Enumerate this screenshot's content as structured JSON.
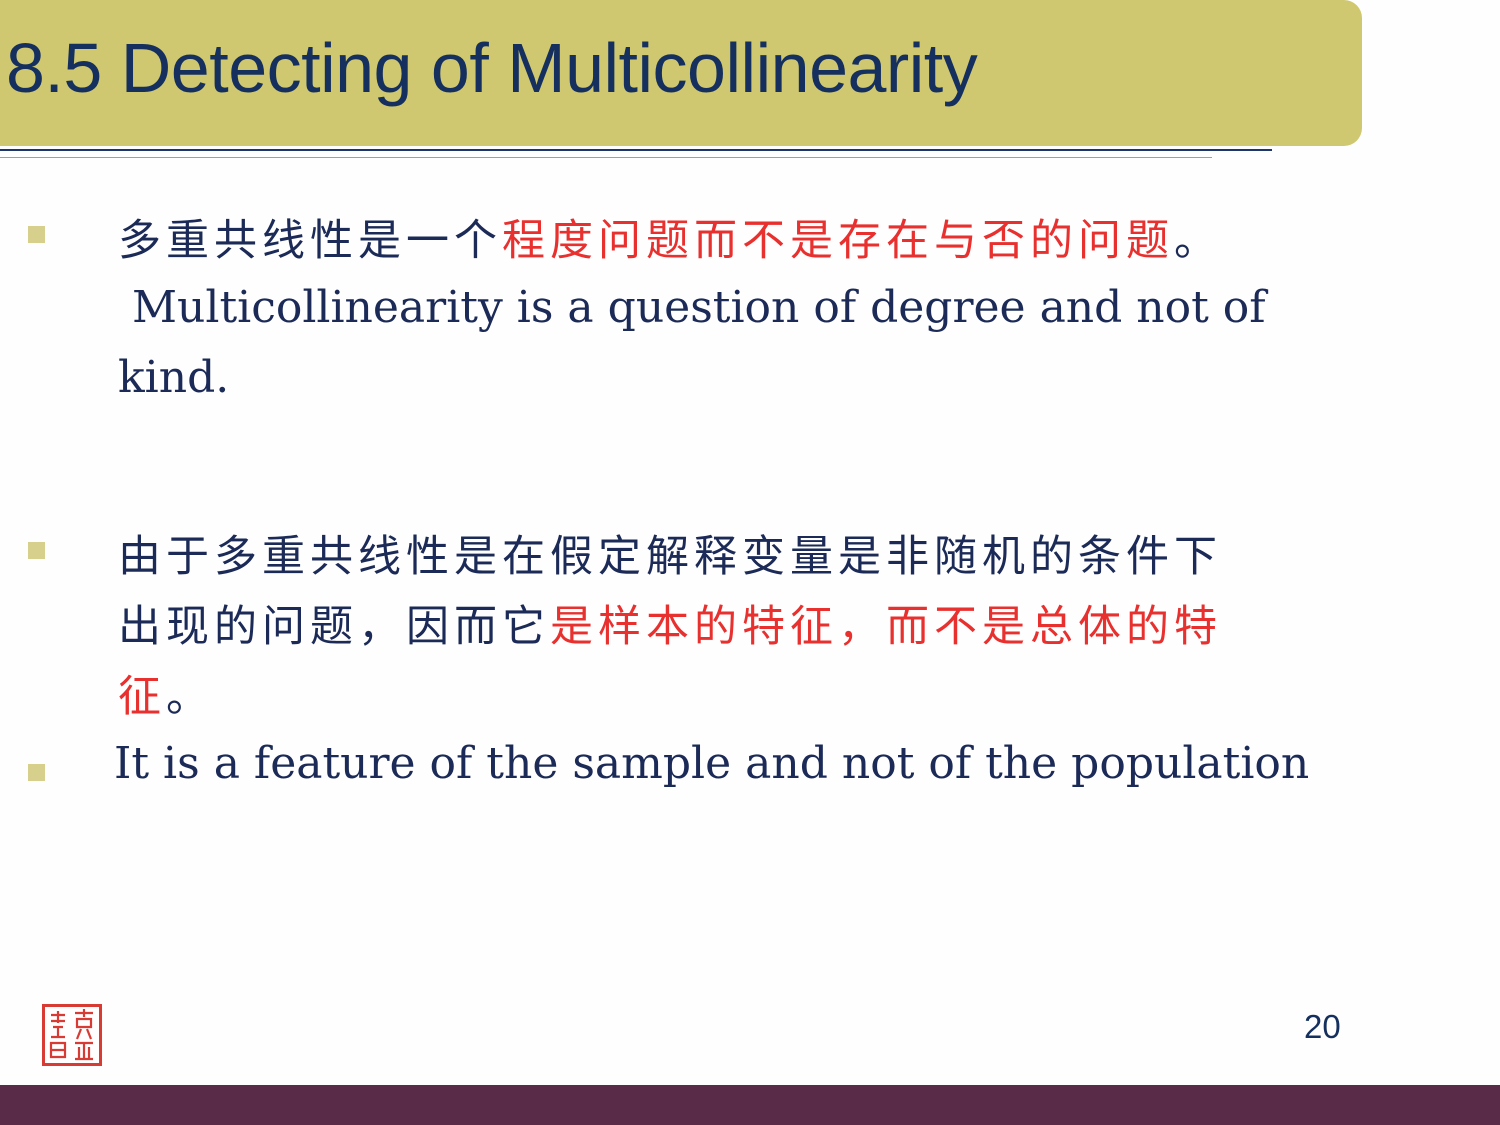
{
  "slide": {
    "title": "8.5 Detecting of Multicollinearity",
    "page_number": "20",
    "colors": {
      "title_bar": "#cfc870",
      "title_text": "#15305e",
      "body_text": "#1b2a57",
      "highlight": "#e8302e",
      "footer": "#5a2b48",
      "bullet": "#d7d08d"
    }
  },
  "bullets": [
    {
      "cn_prefix": "多重共线性是一个",
      "cn_highlight": "程度问题而不是存在与否的问题",
      "cn_suffix": "。",
      "en_line1": " Multicollinearity is a question of degree and not of",
      "en_line2": "kind."
    },
    {
      "cn_line1": "由于多重共线性是在假定解释变量是非随机的条件下",
      "cn_line2_prefix": "出现的问题，因而它",
      "cn_line2_highlight": "是样本的特征，而不是总体的特",
      "cn_line3_highlight": "征",
      "cn_line3_suffix": "。"
    },
    {
      "en": "It is a feature of the sample and not of the population"
    }
  ],
  "logo": {
    "icon": "red-seal-stamp-icon",
    "text": "华中师大"
  }
}
